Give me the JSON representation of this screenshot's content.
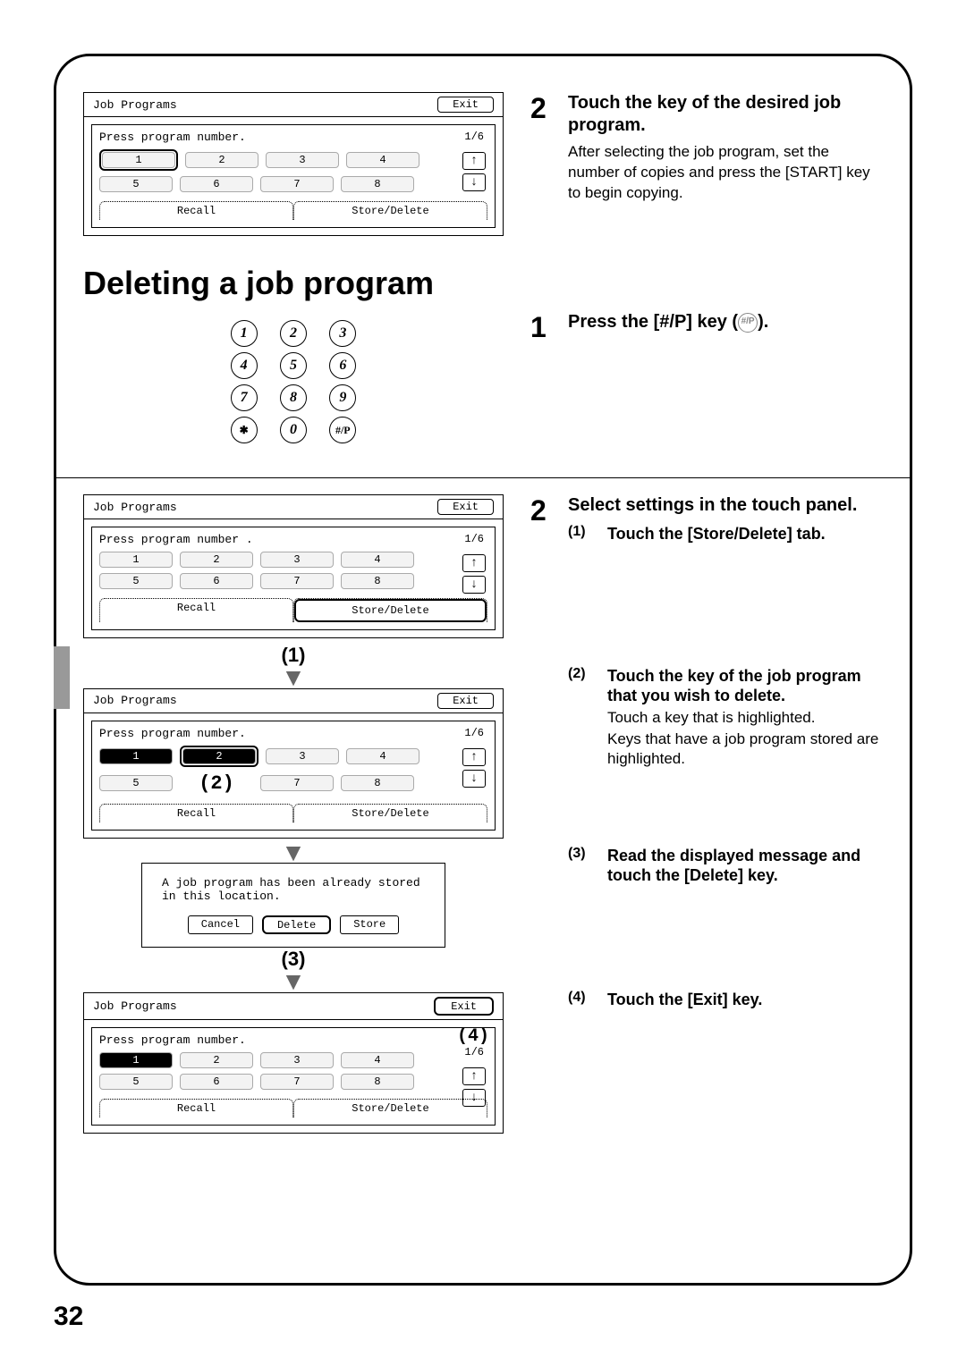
{
  "page_number": "32",
  "heading_delete": "Deleting a job program",
  "panel_generic": {
    "title": "Job Programs",
    "exit": "Exit",
    "prompt": "Press program number.",
    "prompt_dot": "Press program number .",
    "page_indicator": "1/6",
    "numbers": [
      "1",
      "2",
      "3",
      "4",
      "5",
      "6",
      "7",
      "8"
    ],
    "tab_recall": "Recall",
    "tab_store": "Store/Delete",
    "arrow_up": "↑",
    "arrow_down": "↓"
  },
  "keypad": {
    "keys": [
      "1",
      "2",
      "3",
      "4",
      "5",
      "6",
      "7",
      "8",
      "9",
      "✱",
      "0",
      "#/P"
    ]
  },
  "dialog": {
    "message_l1": "A job program has been already stored",
    "message_l2": "in this location.",
    "cancel": "Cancel",
    "delete": "Delete",
    "store": "Store"
  },
  "step2_top": {
    "num": "2",
    "title": "Touch the key of the desired job program.",
    "body": "After selecting the job program, set the number of copies and press the [START] key to begin copying."
  },
  "step1_delete": {
    "num": "1",
    "title_prefix": "Press the [#/P] key (",
    "title_suffix": ").",
    "icon_label": "#/P"
  },
  "step2_delete": {
    "num": "2",
    "title": "Select settings in the touch panel.",
    "sub1": {
      "num": "(1)",
      "title": "Touch the [Store/Delete] tab."
    },
    "sub2": {
      "num": "(2)",
      "title": "Touch the key of the job program that you wish to delete.",
      "body_l1": "Touch a key that is highlighted.",
      "body_l2": "Keys that have a job program stored are highlighted."
    },
    "sub3": {
      "num": "(3)",
      "title": "Read the displayed message and touch the [Delete] key."
    },
    "sub4": {
      "num": "(4)",
      "title": "Touch the [Exit] key."
    }
  },
  "callouts": {
    "c1": "(1)",
    "c2": "(2)",
    "c3": "(3)",
    "c4": "(4)"
  }
}
